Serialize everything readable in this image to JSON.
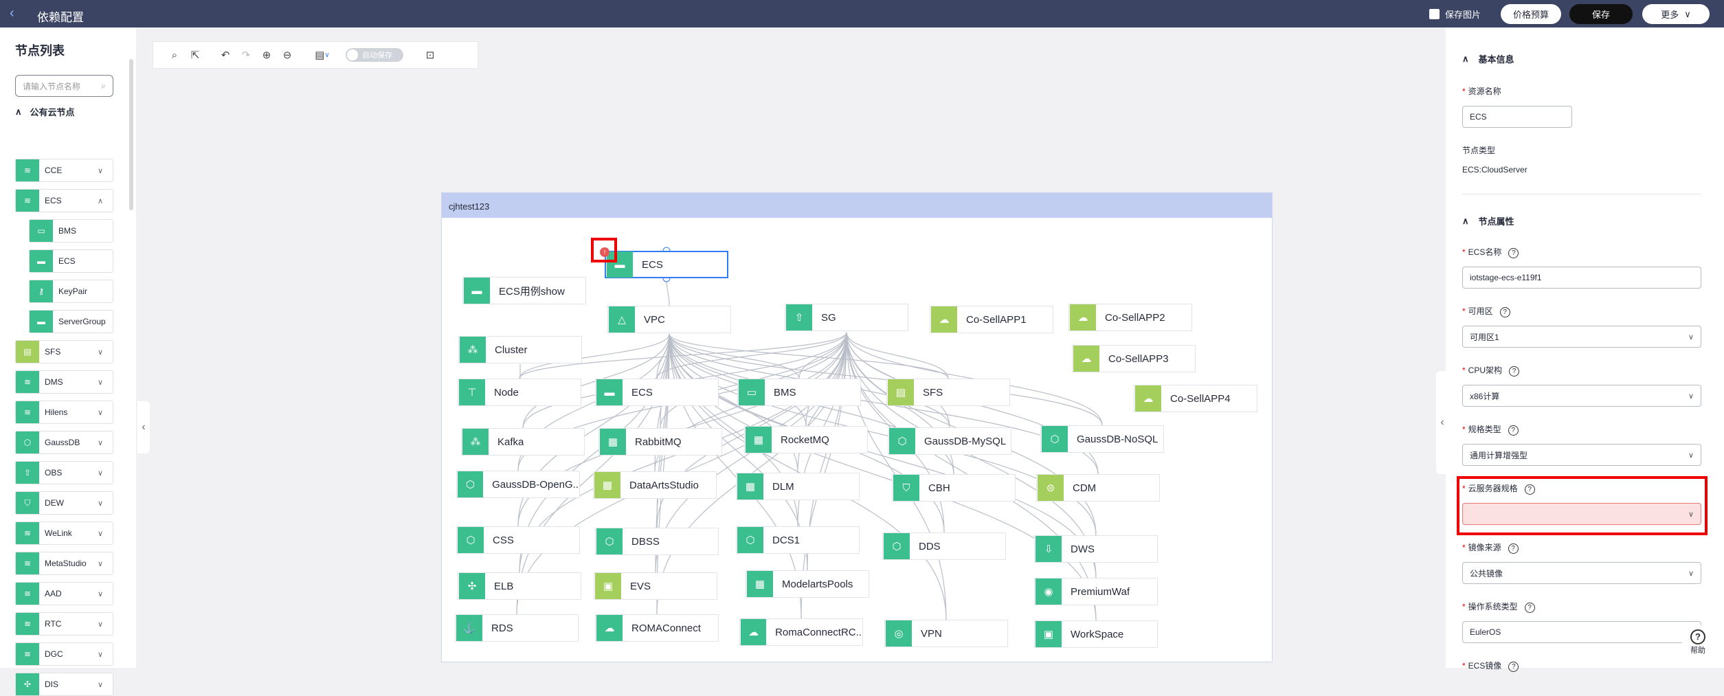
{
  "header": {
    "title": "依赖配置",
    "save_picture": "保存图片",
    "price": "价格预算",
    "save": "保存",
    "more": "更多"
  },
  "sidebar": {
    "title": "节点列表",
    "search_placeholder": "请输入节点名称",
    "group": "公有云节点",
    "items": [
      {
        "label": "CCE",
        "color": "#3bbf8f",
        "icon": "layers-icon",
        "chevron": "∨"
      },
      {
        "label": "ECS",
        "color": "#3bbf8f",
        "icon": "layers-icon",
        "chevron": "∧"
      },
      {
        "label": "BMS",
        "color": "#3bbf8f",
        "icon": "bms-icon",
        "sub": true
      },
      {
        "label": "ECS",
        "color": "#3bbf8f",
        "icon": "server-icon",
        "sub": true
      },
      {
        "label": "KeyPair",
        "color": "#3bbf8f",
        "icon": "key-icon",
        "sub": true
      },
      {
        "label": "ServerGroup",
        "color": "#3bbf8f",
        "icon": "server-icon",
        "sub": true
      },
      {
        "label": "SFS",
        "color": "#a5cf5c",
        "icon": "folder-icon",
        "chevron": "∨"
      },
      {
        "label": "DMS",
        "color": "#3bbf8f",
        "icon": "layers-icon",
        "chevron": "∨"
      },
      {
        "label": "Hilens",
        "color": "#3bbf8f",
        "icon": "layers-icon",
        "chevron": "∨"
      },
      {
        "label": "GaussDB",
        "color": "#3bbf8f",
        "icon": "db-icon",
        "chevron": "∨"
      },
      {
        "label": "OBS",
        "color": "#3bbf8f",
        "icon": "upload-icon",
        "chevron": "∨"
      },
      {
        "label": "DEW",
        "color": "#3bbf8f",
        "icon": "shield-icon",
        "chevron": "∨"
      },
      {
        "label": "WeLink",
        "color": "#3bbf8f",
        "icon": "layers-icon",
        "chevron": "∨"
      },
      {
        "label": "MetaStudio",
        "color": "#3bbf8f",
        "icon": "layers-icon",
        "chevron": "∨"
      },
      {
        "label": "AAD",
        "color": "#3bbf8f",
        "icon": "layers-icon",
        "chevron": "∨"
      },
      {
        "label": "RTC",
        "color": "#3bbf8f",
        "icon": "layers-icon",
        "chevron": "∨"
      },
      {
        "label": "DGC",
        "color": "#3bbf8f",
        "icon": "layers-icon",
        "chevron": "∨"
      },
      {
        "label": "DIS",
        "color": "#3bbf8f",
        "icon": "dis-icon",
        "chevron": "∨"
      }
    ]
  },
  "toolbar": {
    "autosave": "自动保存"
  },
  "canvas": {
    "title": "cjhtest123",
    "error_badge": "!",
    "nodes": [
      {
        "id": "ecs-main",
        "label": "ECS",
        "color": "#3bbf8f",
        "selected": true
      },
      {
        "id": "ecsshow",
        "label": "ECS用例show",
        "color": "#3bbf8f"
      },
      {
        "id": "vpc",
        "label": "VPC",
        "color": "#3bbf8f"
      },
      {
        "id": "sg",
        "label": "SG",
        "color": "#3bbf8f"
      },
      {
        "id": "cosell1",
        "label": "Co-SellAPP1",
        "color": "#a5cf5c"
      },
      {
        "id": "cosell2",
        "label": "Co-SellAPP2",
        "color": "#a5cf5c"
      },
      {
        "id": "cosell3",
        "label": "Co-SellAPP3",
        "color": "#a5cf5c"
      },
      {
        "id": "cosell4",
        "label": "Co-SellAPP4",
        "color": "#a5cf5c"
      },
      {
        "id": "cluster",
        "label": "Cluster",
        "color": "#3bbf8f"
      },
      {
        "id": "node",
        "label": "Node",
        "color": "#3bbf8f"
      },
      {
        "id": "ecs2",
        "label": "ECS",
        "color": "#3bbf8f"
      },
      {
        "id": "bms",
        "label": "BMS",
        "color": "#3bbf8f"
      },
      {
        "id": "sfs",
        "label": "SFS",
        "color": "#a5cf5c"
      },
      {
        "id": "kafka",
        "label": "Kafka",
        "color": "#3bbf8f"
      },
      {
        "id": "rabbitmq",
        "label": "RabbitMQ",
        "color": "#3bbf8f"
      },
      {
        "id": "rocketmq",
        "label": "RocketMQ",
        "color": "#3bbf8f"
      },
      {
        "id": "gaussmysql",
        "label": "GaussDB-MySQL",
        "color": "#3bbf8f"
      },
      {
        "id": "gaussnosql",
        "label": "GaussDB-NoSQL",
        "color": "#3bbf8f"
      },
      {
        "id": "gaussopen",
        "label": "GaussDB-OpenG...",
        "color": "#3bbf8f"
      },
      {
        "id": "dataarts",
        "label": "DataArtsStudio",
        "color": "#a5cf5c"
      },
      {
        "id": "dlm",
        "label": "DLM",
        "color": "#3bbf8f"
      },
      {
        "id": "cbh",
        "label": "CBH",
        "color": "#3bbf8f"
      },
      {
        "id": "cdm",
        "label": "CDM",
        "color": "#a5cf5c"
      },
      {
        "id": "css",
        "label": "CSS",
        "color": "#3bbf8f"
      },
      {
        "id": "dbss",
        "label": "DBSS",
        "color": "#3bbf8f"
      },
      {
        "id": "dcs1",
        "label": "DCS1",
        "color": "#3bbf8f"
      },
      {
        "id": "dds",
        "label": "DDS",
        "color": "#3bbf8f"
      },
      {
        "id": "dws",
        "label": "DWS",
        "color": "#3bbf8f"
      },
      {
        "id": "elb",
        "label": "ELB",
        "color": "#3bbf8f"
      },
      {
        "id": "evs",
        "label": "EVS",
        "color": "#a5cf5c"
      },
      {
        "id": "modelarts",
        "label": "ModelartsPools",
        "color": "#3bbf8f"
      },
      {
        "id": "premiumwaf",
        "label": "PremiumWaf",
        "color": "#3bbf8f"
      },
      {
        "id": "rds",
        "label": "RDS",
        "color": "#3bbf8f"
      },
      {
        "id": "romaconnect",
        "label": "ROMAConnect",
        "color": "#3bbf8f"
      },
      {
        "id": "romaconnectrc",
        "label": "RomaConnectRC...",
        "color": "#3bbf8f"
      },
      {
        "id": "vpn",
        "label": "VPN",
        "color": "#3bbf8f"
      },
      {
        "id": "workspace",
        "label": "WorkSpace",
        "color": "#3bbf8f"
      }
    ]
  },
  "panel": {
    "basic_section": "基本信息",
    "resource_name_label": "资源名称",
    "resource_name_value": "ECS",
    "node_type_label": "节点类型",
    "node_type_value": "ECS:CloudServer",
    "props_section": "节点属性",
    "ecs_name_label": "ECS名称",
    "ecs_name_value": "iotstage-ecs-e119f1",
    "az_label": "可用区",
    "az_value": "可用区1",
    "cpu_label": "CPU架构",
    "cpu_value": "x86计算",
    "spec_type_label": "规格类型",
    "spec_type_value": "通用计算增强型",
    "flavor_label": "云服务器规格",
    "flavor_value": "",
    "image_src_label": "镜像来源",
    "image_src_value": "公共镜像",
    "os_label": "操作系统类型",
    "os_value": "EulerOS",
    "ecs_image_label": "ECS镜像"
  },
  "help": "帮助"
}
